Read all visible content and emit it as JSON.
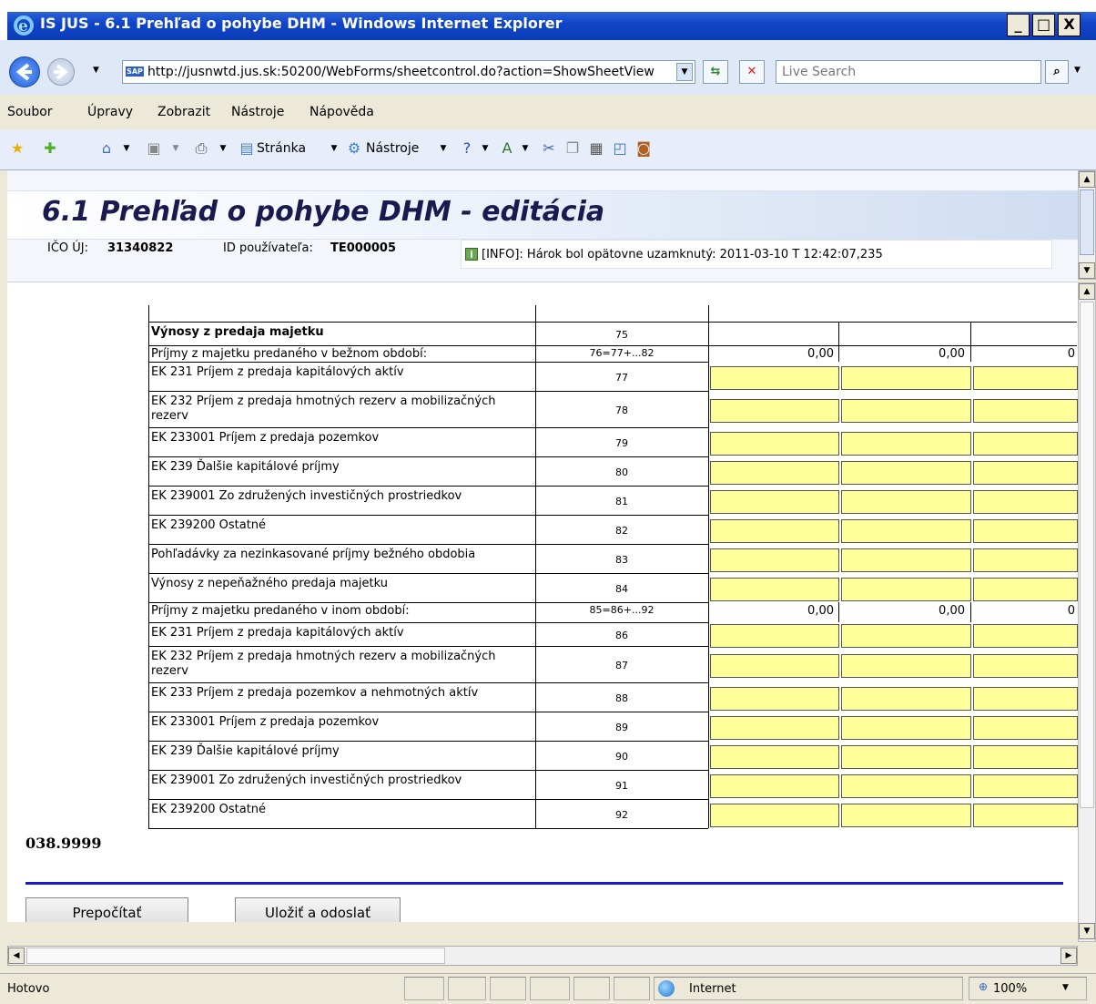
{
  "window": {
    "title": "IS JUS - 6.1 Prehľad o pohybe DHM - Windows Internet Explorer",
    "min": "_",
    "max": "□",
    "close": "X"
  },
  "address": {
    "url": "http://jusnwtd.jus.sk:50200/WebForms/sheetcontrol.do?action=ShowSheetView",
    "search_placeholder": "Live Search",
    "sap": "SAP"
  },
  "menu": {
    "items": [
      "Soubor",
      "Úpravy",
      "Zobrazit",
      "Nástroje",
      "Nápověda"
    ]
  },
  "toolbar": {
    "page_label": "Stránka",
    "tools_label": "Nástroje"
  },
  "header": {
    "title": "6.1 Prehľad o pohybe DHM - editácia",
    "ico_label": "IČO ÚJ:",
    "ico_value": "31340822",
    "user_label": "ID používateľa:",
    "user_value": "TE000005",
    "info": "[INFO]: Hárok bol opätovne uzamknutý: 2011-03-10 T 12:42:07,235"
  },
  "table": {
    "rows": [
      {
        "label": "Výnosy z predaja majetku",
        "num": "75",
        "bold": true,
        "kind": "empty"
      },
      {
        "label": "Príjmy z majetku predaného v bežnom období:",
        "num": "76=77+...82",
        "kind": "values",
        "values": [
          "0,00",
          "0,00",
          "0"
        ]
      },
      {
        "label": "EK 231 Príjem z predaja kapitálových aktív",
        "num": "77",
        "kind": "input"
      },
      {
        "label": "EK 232 Príjem z predaja hmotných rezerv a mobilizačných",
        "label2": "rezerv",
        "num": "78",
        "kind": "input"
      },
      {
        "label": "EK 233001 Príjem z predaja pozemkov",
        "num": "79",
        "kind": "input"
      },
      {
        "label": "EK 239 Ďalšie kapitálové príjmy",
        "num": "80",
        "kind": "input"
      },
      {
        "label": "EK 239001 Zo združených investičných prostriedkov",
        "num": "81",
        "kind": "input"
      },
      {
        "label": "EK 239200 Ostatné",
        "num": "82",
        "kind": "input"
      },
      {
        "label": "Pohľadávky za nezinkasované príjmy bežného obdobia",
        "num": "83",
        "kind": "input"
      },
      {
        "label": "Výnosy z nepeňažného predaja majetku",
        "num": "84",
        "kind": "input"
      },
      {
        "label": "Príjmy z majetku predaného v inom období:",
        "num": "85=86+...92",
        "kind": "values",
        "values": [
          "0,00",
          "0,00",
          "0"
        ]
      },
      {
        "label": "EK 231 Príjem z predaja kapitálových aktív",
        "num": "86",
        "kind": "input"
      },
      {
        "label": "EK 232 Príjem z predaja hmotných rezerv a mobilizačných",
        "label2": "rezerv",
        "num": "87",
        "kind": "input"
      },
      {
        "label": "EK 233 Príjem z predaja pozemkov a nehmotných aktív",
        "num": "88",
        "kind": "input"
      },
      {
        "label": "EK 233001 Príjem z predaja pozemkov",
        "num": "89",
        "kind": "input"
      },
      {
        "label": "EK 239 Ďalšie kapitálové príjmy",
        "num": "90",
        "kind": "input"
      },
      {
        "label": "EK 239001 Zo združených investičných prostriedkov",
        "num": "91",
        "kind": "input"
      },
      {
        "label": "EK 239200 Ostatné",
        "num": "92",
        "kind": "input"
      }
    ]
  },
  "footer": {
    "code": "038.9999",
    "recalc": "Prepočítať",
    "save": "Uložiť a odoslať"
  },
  "status": {
    "text": "Hotovo",
    "zone": "Internet",
    "zoom": "100%"
  },
  "colors": {
    "input_fill": "#ffff99",
    "title_bar": "#1145c7",
    "rule": "#1a1acc"
  }
}
